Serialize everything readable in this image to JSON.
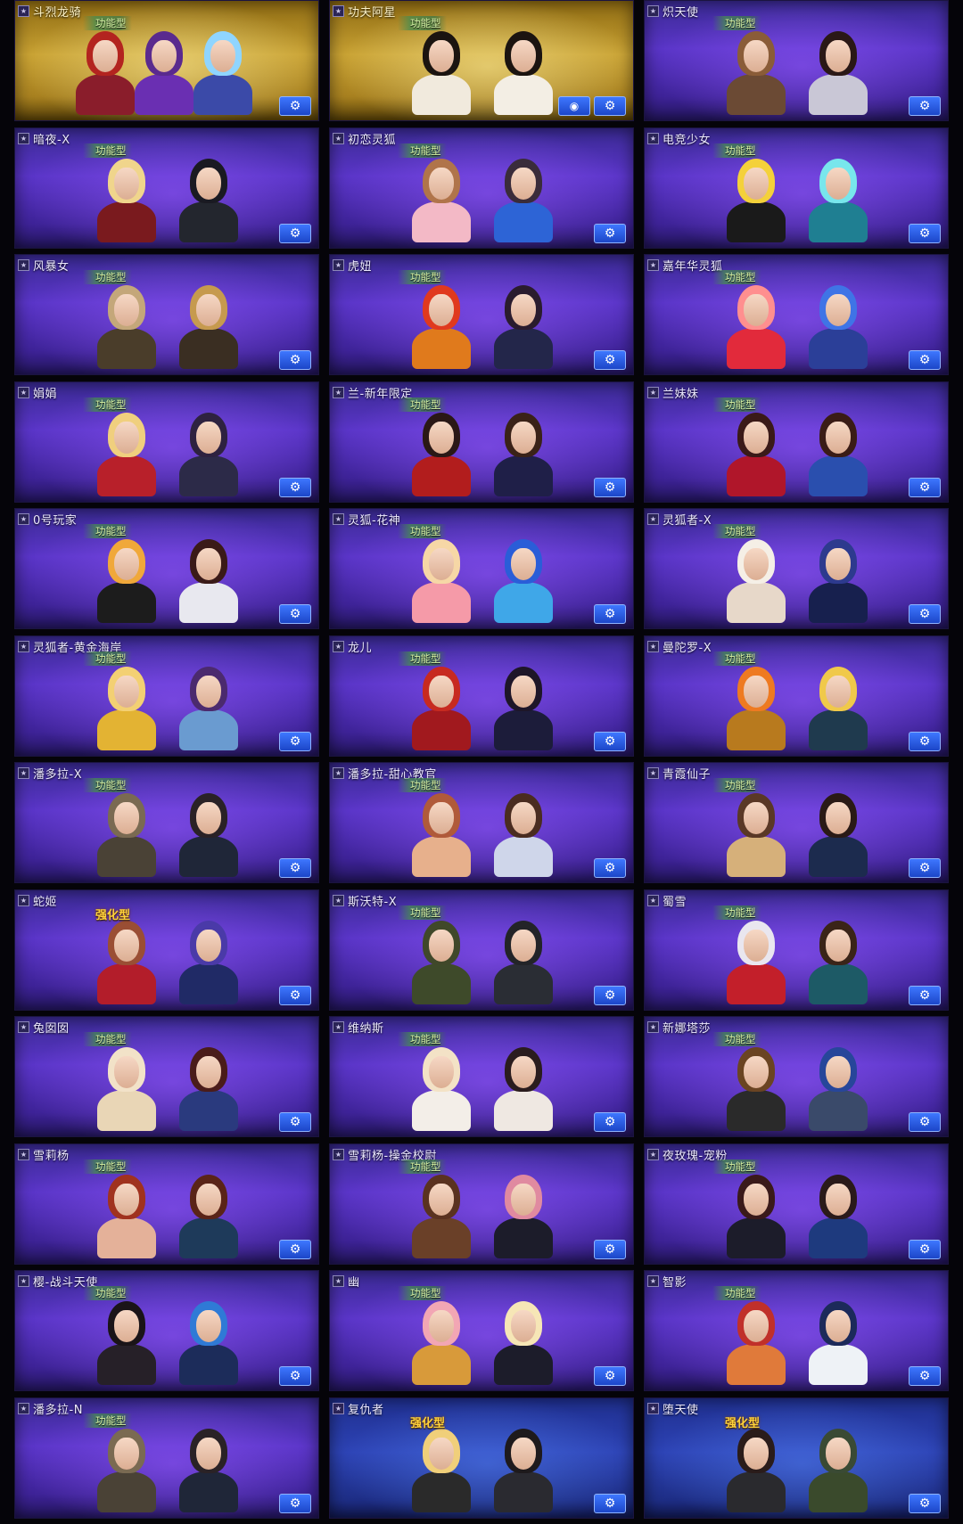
{
  "cards": [
    {
      "name": "斗烈龙骑",
      "type": "功能型",
      "bg": "gold",
      "figures": [
        {
          "hair": "#b3241f",
          "body": "#8a1d2b"
        },
        {
          "hair": "#5a2a8e",
          "body": "#6a2fb2"
        },
        {
          "hair": "#8fd5ff",
          "body": "#3b4aa8"
        }
      ],
      "extra_icon": false
    },
    {
      "name": "功夫阿星",
      "type": "功能型",
      "bg": "gold",
      "figures": [
        {
          "hair": "#1b1410",
          "body": "#f1eadd"
        },
        {
          "hair": "#1b1410",
          "body": "#f3eee4"
        }
      ],
      "extra_icon": true
    },
    {
      "name": "炽天使",
      "type": "功能型",
      "bg": "purple",
      "figures": [
        {
          "hair": "#8a5c38",
          "body": "#6b4a34"
        },
        {
          "hair": "#2a1816",
          "body": "#c9c7d6"
        }
      ],
      "extra_icon": false
    },
    {
      "name": "暗夜-X",
      "type": "功能型",
      "bg": "purple",
      "figures": [
        {
          "hair": "#f0d58c",
          "body": "#7a1a1e"
        },
        {
          "hair": "#1a1a22",
          "body": "#23262e"
        }
      ],
      "extra_icon": false
    },
    {
      "name": "初恋灵狐",
      "type": "功能型",
      "bg": "purple",
      "figures": [
        {
          "hair": "#b0744a",
          "body": "#f3b9c6"
        },
        {
          "hair": "#3a2c3a",
          "body": "#2d64d6"
        }
      ],
      "extra_icon": false
    },
    {
      "name": "电竞少女",
      "type": "功能型",
      "bg": "purple",
      "figures": [
        {
          "hair": "#f4d13a",
          "body": "#1a1a1a"
        },
        {
          "hair": "#78e6ec",
          "body": "#1f7f92"
        }
      ],
      "extra_icon": false
    },
    {
      "name": "风暴女",
      "type": "功能型",
      "bg": "purple",
      "figures": [
        {
          "hair": "#c4a77a",
          "body": "#4a3d2a"
        },
        {
          "hair": "#c69a4e",
          "body": "#3a2e22"
        }
      ],
      "extra_icon": false
    },
    {
      "name": "虎妞",
      "type": "功能型",
      "bg": "purple",
      "figures": [
        {
          "hair": "#e0391e",
          "body": "#e07a1c"
        },
        {
          "hair": "#2a1c2e",
          "body": "#23264a"
        }
      ],
      "extra_icon": false
    },
    {
      "name": "嘉年华灵狐",
      "type": "功能型",
      "bg": "purple",
      "figures": [
        {
          "hair": "#ff8f8f",
          "body": "#e22a3b"
        },
        {
          "hair": "#3f74e6",
          "body": "#2b3f98"
        }
      ],
      "extra_icon": false
    },
    {
      "name": "娟娟",
      "type": "功能型",
      "bg": "purple",
      "figures": [
        {
          "hair": "#f0cf7e",
          "body": "#b8202a"
        },
        {
          "hair": "#2e2240",
          "body": "#2c2a48"
        }
      ],
      "extra_icon": false
    },
    {
      "name": "兰-新年限定",
      "type": "功能型",
      "bg": "purple",
      "figures": [
        {
          "hair": "#2a1816",
          "body": "#b21d1d"
        },
        {
          "hair": "#3a2218",
          "body": "#1f1f48"
        }
      ],
      "extra_icon": false
    },
    {
      "name": "兰妹妹",
      "type": "功能型",
      "bg": "purple",
      "figures": [
        {
          "hair": "#3a1a18",
          "body": "#b0162a"
        },
        {
          "hair": "#3a1c16",
          "body": "#2a4fae"
        }
      ],
      "extra_icon": false
    },
    {
      "name": "0号玩家",
      "type": "功能型",
      "bg": "purple",
      "figures": [
        {
          "hair": "#f0a83a",
          "body": "#1c1c1c"
        },
        {
          "hair": "#3a1a18",
          "body": "#e8e8ef"
        }
      ],
      "extra_icon": false
    },
    {
      "name": "灵狐-花神",
      "type": "功能型",
      "bg": "purple",
      "figures": [
        {
          "hair": "#f6d7a6",
          "body": "#f59aa8"
        },
        {
          "hair": "#2a5dd8",
          "body": "#3fa7e8"
        }
      ],
      "extra_icon": false
    },
    {
      "name": "灵狐者-X",
      "type": "功能型",
      "bg": "purple",
      "figures": [
        {
          "hair": "#f5efe6",
          "body": "#e7d8c9"
        },
        {
          "hair": "#2d3a8e",
          "body": "#17204e"
        }
      ],
      "extra_icon": false
    },
    {
      "name": "灵狐者-黄金海岸",
      "type": "功能型",
      "bg": "purple",
      "figures": [
        {
          "hair": "#f3d073",
          "body": "#e3b333"
        },
        {
          "hair": "#4b2a6e",
          "body": "#6a9bd0"
        }
      ],
      "extra_icon": false
    },
    {
      "name": "龙儿",
      "type": "功能型",
      "bg": "purple",
      "figures": [
        {
          "hair": "#c72a20",
          "body": "#a1191e"
        },
        {
          "hair": "#1e1628",
          "body": "#1c1c3a"
        }
      ],
      "extra_icon": false
    },
    {
      "name": "曼陀罗-X",
      "type": "功能型",
      "bg": "purple",
      "figures": [
        {
          "hair": "#ee7a21",
          "body": "#b87a1e"
        },
        {
          "hair": "#f0c94a",
          "body": "#1f3a4e"
        }
      ],
      "extra_icon": false
    },
    {
      "name": "潘多拉-X",
      "type": "功能型",
      "bg": "purple",
      "figures": [
        {
          "hair": "#7a6a52",
          "body": "#4a4236"
        },
        {
          "hair": "#2a2226",
          "body": "#1f2638"
        }
      ],
      "extra_icon": false
    },
    {
      "name": "潘多拉-甜心教官",
      "type": "功能型",
      "bg": "purple",
      "figures": [
        {
          "hair": "#b05a3a",
          "body": "#e7b08c"
        },
        {
          "hair": "#4a2c20",
          "body": "#cfd6ea"
        }
      ],
      "extra_icon": false
    },
    {
      "name": "青霞仙子",
      "type": "功能型",
      "bg": "purple",
      "figures": [
        {
          "hair": "#5a3826",
          "body": "#d6b07a"
        },
        {
          "hair": "#2a1a16",
          "body": "#1c2b4e"
        }
      ],
      "extra_icon": false
    },
    {
      "name": "蛇姬",
      "type": "强化型",
      "bg": "purple",
      "figures": [
        {
          "hair": "#9a4e34",
          "body": "#b31d2a"
        },
        {
          "hair": "#4a3aa8",
          "body": "#202a66"
        }
      ],
      "extra_icon": false
    },
    {
      "name": "斯沃特-X",
      "type": "功能型",
      "bg": "purple",
      "figures": [
        {
          "hair": "#40482a",
          "body": "#3e4a2a"
        },
        {
          "hair": "#232428",
          "body": "#2a2d34"
        }
      ],
      "extra_icon": false
    },
    {
      "name": "蜀雪",
      "type": "功能型",
      "bg": "purple",
      "figures": [
        {
          "hair": "#e9e6ef",
          "body": "#c31f2a"
        },
        {
          "hair": "#3a2418",
          "body": "#1d5a66"
        }
      ],
      "extra_icon": false
    },
    {
      "name": "兔囡囡",
      "type": "功能型",
      "bg": "purple",
      "figures": [
        {
          "hair": "#f2e2c8",
          "body": "#e9d6b6"
        },
        {
          "hair": "#4a1c1a",
          "body": "#2a3a7e"
        }
      ],
      "extra_icon": false
    },
    {
      "name": "维纳斯",
      "type": "功能型",
      "bg": "purple",
      "figures": [
        {
          "hair": "#f3e2c6",
          "body": "#f3eee8"
        },
        {
          "hair": "#2a1c1e",
          "body": "#efe8e2"
        }
      ],
      "extra_icon": false
    },
    {
      "name": "新娜塔莎",
      "type": "功能型",
      "bg": "purple",
      "figures": [
        {
          "hair": "#6a4422",
          "body": "#2a2a2a"
        },
        {
          "hair": "#27469a",
          "body": "#3a4a6a"
        }
      ],
      "extra_icon": false
    },
    {
      "name": "雪莉杨",
      "type": "功能型",
      "bg": "purple",
      "figures": [
        {
          "hair": "#a0321e",
          "body": "#e4b199"
        },
        {
          "hair": "#5a2418",
          "body": "#1e3a5a"
        }
      ],
      "extra_icon": false
    },
    {
      "name": "雪莉杨-操金校尉",
      "type": "功能型",
      "bg": "purple",
      "figures": [
        {
          "hair": "#5a3220",
          "body": "#6a4028"
        },
        {
          "hair": "#e08aa0",
          "body": "#1c1c2a"
        }
      ],
      "extra_icon": false
    },
    {
      "name": "夜玫瑰-宠粉",
      "type": "功能型",
      "bg": "purple",
      "figures": [
        {
          "hair": "#3a1a1a",
          "body": "#1c1c2a"
        },
        {
          "hair": "#2a1a1a",
          "body": "#1e3a7e"
        }
      ],
      "extra_icon": false
    },
    {
      "name": "樱-战斗天使",
      "type": "功能型",
      "bg": "purple",
      "figures": [
        {
          "hair": "#1a1418",
          "body": "#262028"
        },
        {
          "hair": "#2f7ad6",
          "body": "#1c2c5a"
        }
      ],
      "extra_icon": false
    },
    {
      "name": "幽",
      "type": "功能型",
      "bg": "purple",
      "figures": [
        {
          "hair": "#f2a6b4",
          "body": "#d89a3a"
        },
        {
          "hair": "#f6e6b6",
          "body": "#1c1c2a"
        }
      ],
      "extra_icon": false
    },
    {
      "name": "智影",
      "type": "功能型",
      "bg": "purple",
      "figures": [
        {
          "hair": "#c0302a",
          "body": "#e07a3a"
        },
        {
          "hair": "#1c2a5a",
          "body": "#eef2f6"
        }
      ],
      "extra_icon": false
    },
    {
      "name": "潘多拉-N",
      "type": "功能型",
      "bg": "purple",
      "figures": [
        {
          "hair": "#7a6a52",
          "body": "#4a4236"
        },
        {
          "hair": "#2a2226",
          "body": "#1f2638"
        }
      ],
      "extra_icon": false
    },
    {
      "name": "复仇者",
      "type": "强化型",
      "bg": "deep",
      "figures": [
        {
          "hair": "#f0cf7a",
          "body": "#2a2a2a"
        },
        {
          "hair": "#1e1a1c",
          "body": "#2a2a30"
        }
      ],
      "extra_icon": false
    },
    {
      "name": "堕天使",
      "type": "强化型",
      "bg": "deep",
      "figures": [
        {
          "hair": "#2a1c1a",
          "body": "#2a2a2e"
        },
        {
          "hair": "#3a4a34",
          "body": "#3a4a2c"
        }
      ],
      "extra_icon": false
    }
  ],
  "icons": {
    "rank": "rank-badge-icon",
    "settings": "settings-icon",
    "extra": "record-icon"
  }
}
